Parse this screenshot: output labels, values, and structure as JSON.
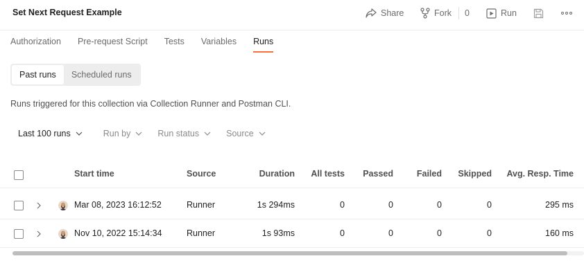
{
  "header": {
    "title": "Set Next Request Example",
    "share_label": "Share",
    "fork_label": "Fork",
    "fork_count": "0",
    "run_label": "Run"
  },
  "tabs": [
    {
      "label": "Authorization"
    },
    {
      "label": "Pre-request Script"
    },
    {
      "label": "Tests"
    },
    {
      "label": "Variables"
    },
    {
      "label": "Runs",
      "active": true
    }
  ],
  "segments": {
    "past_runs": "Past runs",
    "scheduled_runs": "Scheduled runs"
  },
  "description": "Runs triggered for this collection via Collection Runner and Postman CLI.",
  "filters": {
    "count": "Last 100 runs",
    "run_by": "Run by",
    "run_status": "Run status",
    "source": "Source"
  },
  "table": {
    "headers": {
      "start_time": "Start time",
      "source": "Source",
      "duration": "Duration",
      "all_tests": "All tests",
      "passed": "Passed",
      "failed": "Failed",
      "skipped": "Skipped",
      "avg_resp": "Avg. Resp. Time"
    },
    "rows": [
      {
        "start_time": "Mar 08, 2023 16:12:52",
        "source": "Runner",
        "duration": "1s 294ms",
        "all_tests": "0",
        "passed": "0",
        "failed": "0",
        "skipped": "0",
        "avg_resp": "295 ms"
      },
      {
        "start_time": "Nov 10, 2022 15:14:34",
        "source": "Runner",
        "duration": "1s 93ms",
        "all_tests": "0",
        "passed": "0",
        "failed": "0",
        "skipped": "0",
        "avg_resp": "160 ms"
      }
    ]
  },
  "colors": {
    "accent": "#ff6c37",
    "text": "#212121",
    "muted": "#6b6b6b",
    "border": "#ededed"
  },
  "icons": [
    "share-icon",
    "fork-icon",
    "run-icon",
    "save-icon",
    "more-icon",
    "chevron-down-icon",
    "chevron-right-icon",
    "avatar"
  ]
}
